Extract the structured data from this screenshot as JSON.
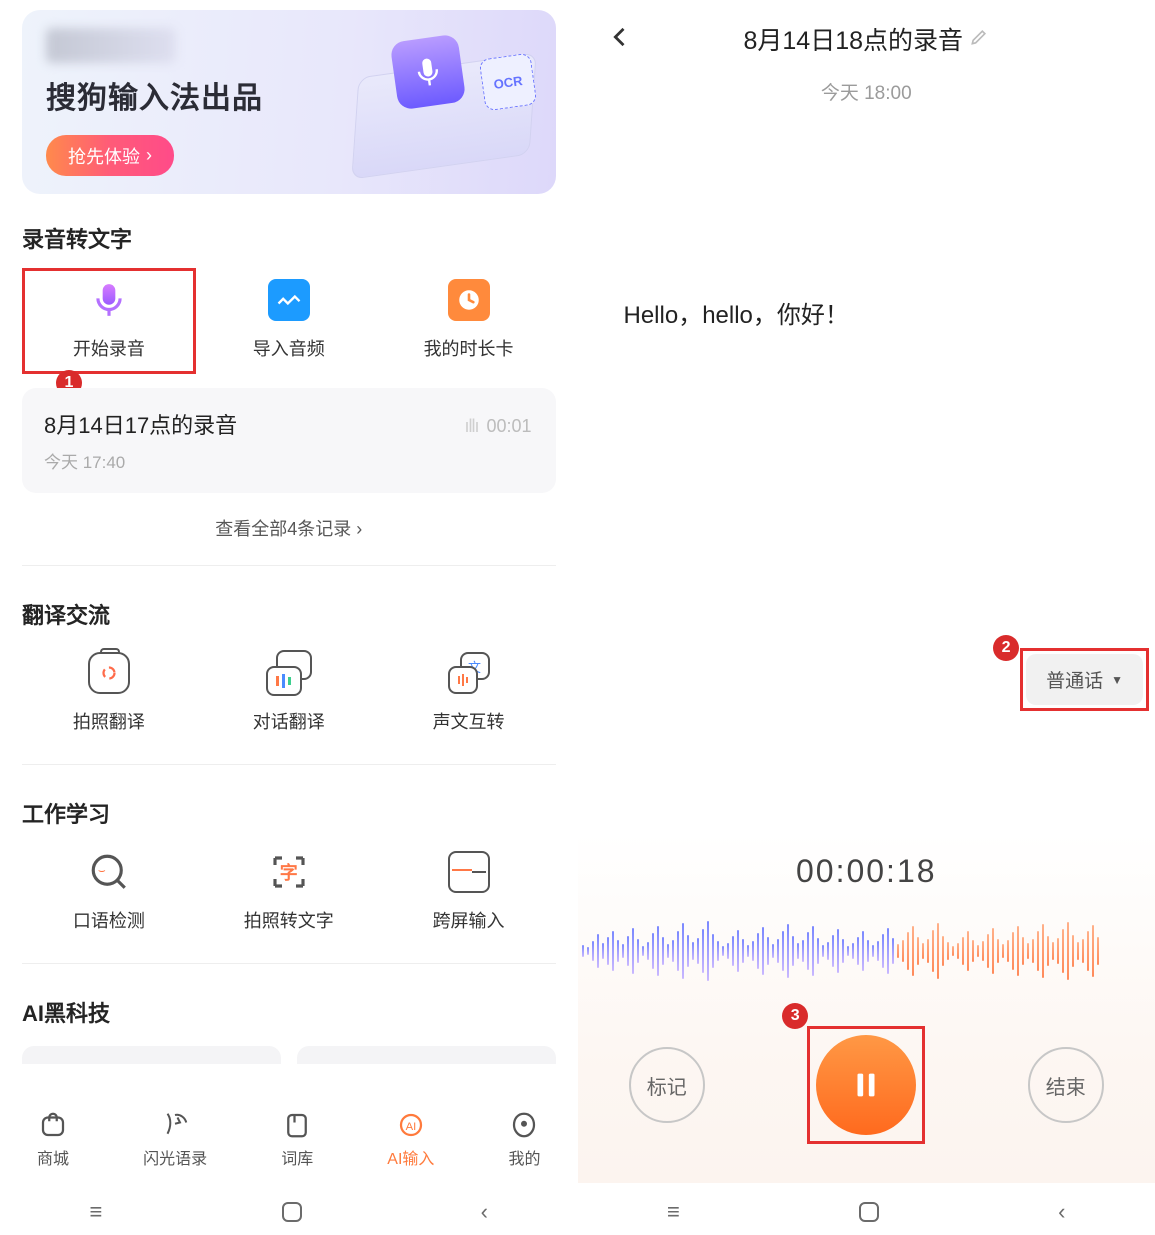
{
  "banner": {
    "title": "搜狗输入法出品",
    "cta": "抢先体验",
    "ocr": "OCR"
  },
  "sections": {
    "record": {
      "title": "录音转文字",
      "items": [
        "开始录音",
        "导入音频",
        "我的时长卡"
      ]
    },
    "translate": {
      "title": "翻译交流",
      "items": [
        "拍照翻译",
        "对话翻译",
        "声文互转"
      ]
    },
    "work": {
      "title": "工作学习",
      "items": [
        "口语检测",
        "拍照转文字",
        "跨屏输入"
      ]
    },
    "ai": {
      "title": "AI黑科技"
    }
  },
  "recent": {
    "title": "8月14日17点的录音",
    "time": "今天 17:40",
    "duration": "00:01",
    "viewall": "查看全部4条记录"
  },
  "tabs": {
    "items": [
      "商城",
      "闪光语录",
      "词库",
      "AI输入",
      "我的"
    ],
    "active": 3
  },
  "right": {
    "title": "8月14日18点的录音",
    "time": "今天 18:00",
    "transcript": "Hello，hello，你好！",
    "language": "普通话",
    "timer": "00:00:18",
    "mark": "标记",
    "end": "结束"
  },
  "badges": {
    "one": "1",
    "two": "2",
    "three": "3"
  },
  "chevron": "›"
}
